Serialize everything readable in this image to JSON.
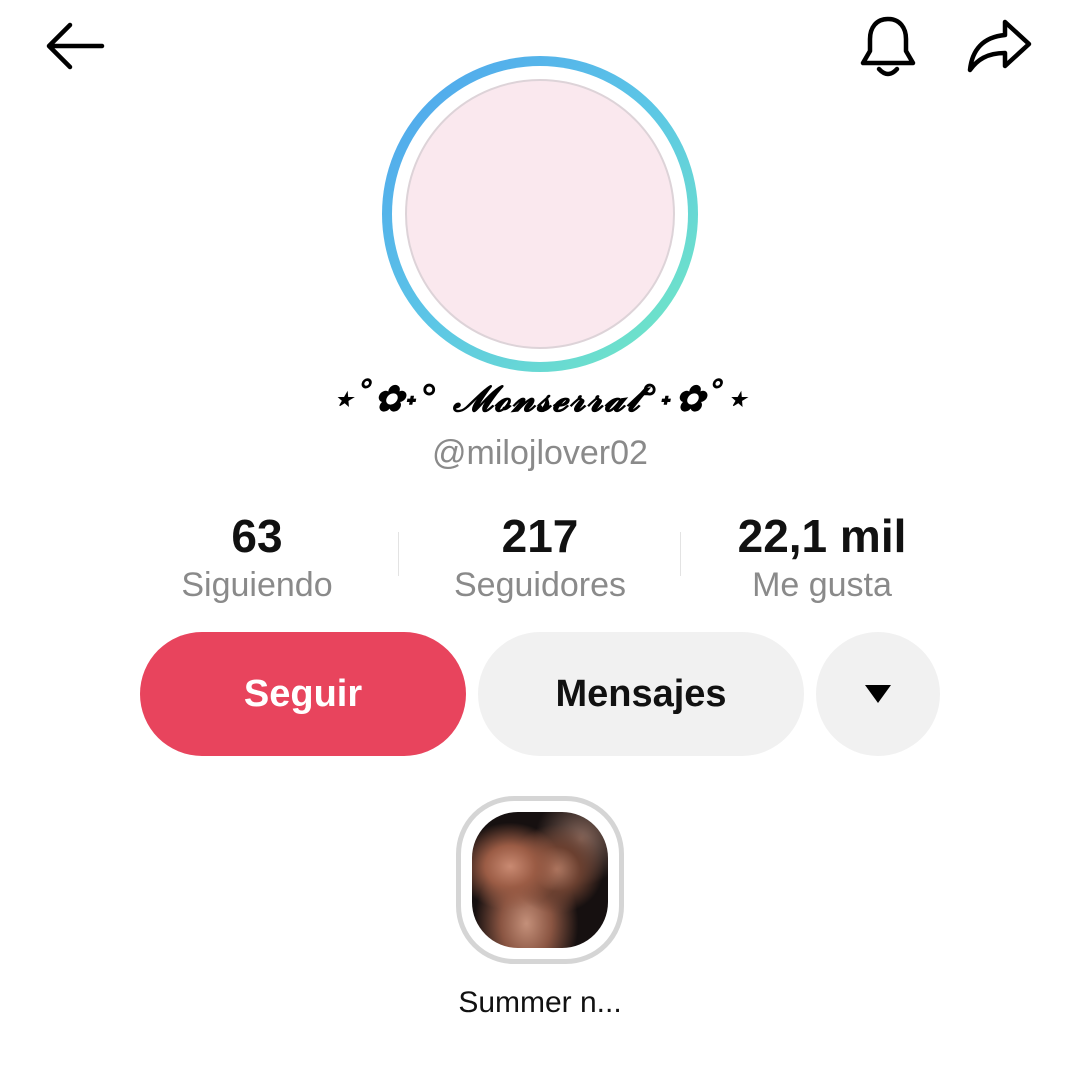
{
  "header": {
    "back_icon": "arrow-left-icon",
    "notification_icon": "bell-icon",
    "share_icon": "share-arrow-icon"
  },
  "profile": {
    "display_name": "⋆˚✿˖° 𝓜𝓸𝓷𝓼𝓮𝓻𝓻𝓪𝓽°˖✿˚⋆",
    "username": "@milojlover02",
    "avatar_ring_colors": [
      "#4ea2ee",
      "#74ecc0"
    ],
    "avatar_color": "#fae8ee"
  },
  "stats": {
    "following": {
      "value": "63",
      "label": "Siguiendo"
    },
    "followers": {
      "value": "217",
      "label": "Seguidores"
    },
    "likes": {
      "value": "22,1 mil",
      "label": "Me gusta"
    }
  },
  "actions": {
    "follow_label": "Seguir",
    "message_label": "Mensajes",
    "more_icon": "caret-down-icon",
    "follow_color": "#e8445d"
  },
  "highlight": {
    "label": "Summer n..."
  }
}
